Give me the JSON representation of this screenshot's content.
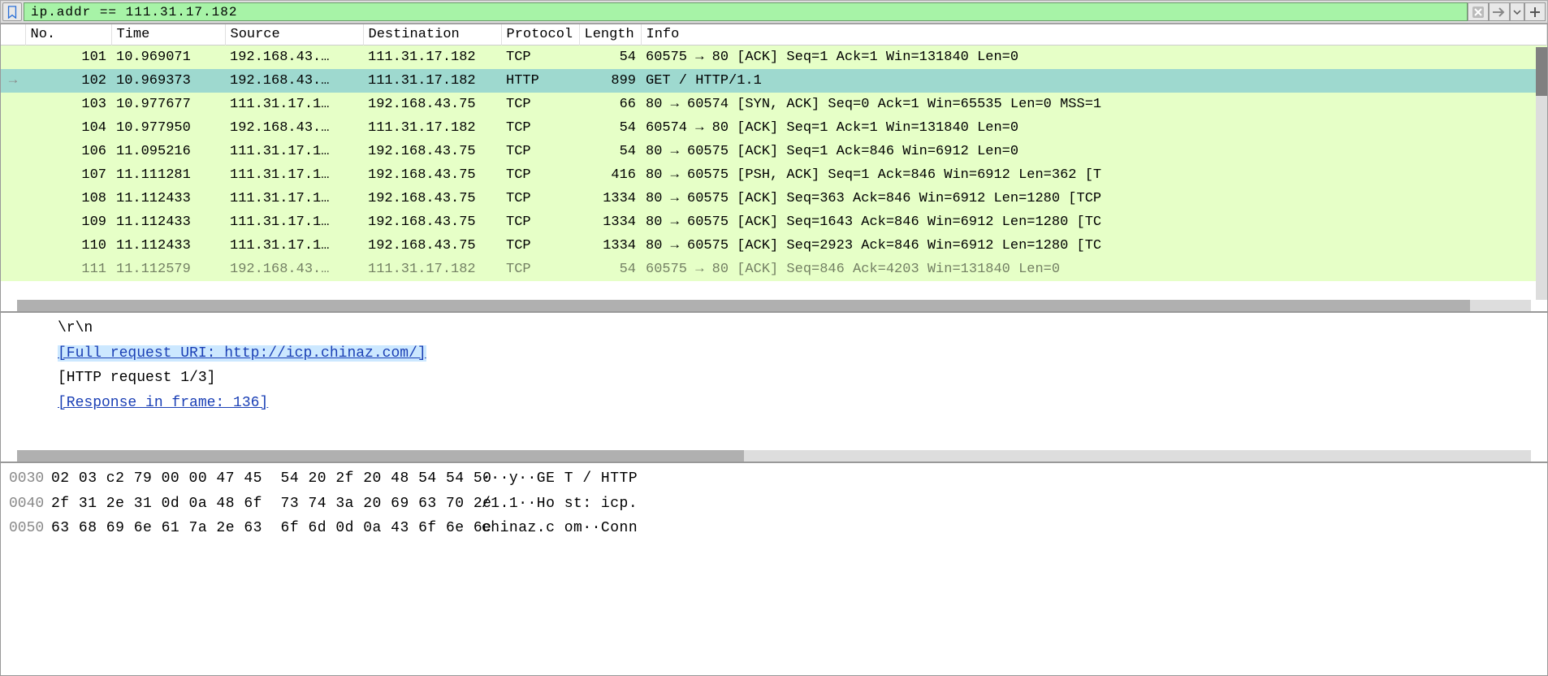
{
  "filter": {
    "value": "ip.addr == 111.31.17.182"
  },
  "columns": {
    "no": "No.",
    "time": "Time",
    "source": "Source",
    "destination": "Destination",
    "protocol": "Protocol",
    "length": "Length",
    "info": "Info"
  },
  "packets": [
    {
      "no": "101",
      "time": "10.969071",
      "src": "192.168.43.…",
      "dst": "111.31.17.182",
      "proto": "TCP",
      "len": "54",
      "info": "60575 → 80 [ACK] Seq=1 Ack=1 Win=131840 Len=0",
      "selected": false,
      "marker": ""
    },
    {
      "no": "102",
      "time": "10.969373",
      "src": "192.168.43.…",
      "dst": "111.31.17.182",
      "proto": "HTTP",
      "len": "899",
      "info": "GET / HTTP/1.1",
      "selected": true,
      "marker": "→"
    },
    {
      "no": "103",
      "time": "10.977677",
      "src": "111.31.17.1…",
      "dst": "192.168.43.75",
      "proto": "TCP",
      "len": "66",
      "info": "80 → 60574 [SYN, ACK] Seq=0 Ack=1 Win=65535 Len=0 MSS=1",
      "selected": false,
      "marker": ""
    },
    {
      "no": "104",
      "time": "10.977950",
      "src": "192.168.43.…",
      "dst": "111.31.17.182",
      "proto": "TCP",
      "len": "54",
      "info": "60574 → 80 [ACK] Seq=1 Ack=1 Win=131840 Len=0",
      "selected": false,
      "marker": ""
    },
    {
      "no": "106",
      "time": "11.095216",
      "src": "111.31.17.1…",
      "dst": "192.168.43.75",
      "proto": "TCP",
      "len": "54",
      "info": "80 → 60575 [ACK] Seq=1 Ack=846 Win=6912 Len=0",
      "selected": false,
      "marker": ""
    },
    {
      "no": "107",
      "time": "11.111281",
      "src": "111.31.17.1…",
      "dst": "192.168.43.75",
      "proto": "TCP",
      "len": "416",
      "info": "80 → 60575 [PSH, ACK] Seq=1 Ack=846 Win=6912 Len=362 [T",
      "selected": false,
      "marker": ""
    },
    {
      "no": "108",
      "time": "11.112433",
      "src": "111.31.17.1…",
      "dst": "192.168.43.75",
      "proto": "TCP",
      "len": "1334",
      "info": "80 → 60575 [ACK] Seq=363 Ack=846 Win=6912 Len=1280 [TCP",
      "selected": false,
      "marker": ""
    },
    {
      "no": "109",
      "time": "11.112433",
      "src": "111.31.17.1…",
      "dst": "192.168.43.75",
      "proto": "TCP",
      "len": "1334",
      "info": "80 → 60575 [ACK] Seq=1643 Ack=846 Win=6912 Len=1280 [TC",
      "selected": false,
      "marker": ""
    },
    {
      "no": "110",
      "time": "11.112433",
      "src": "111.31.17.1…",
      "dst": "192.168.43.75",
      "proto": "TCP",
      "len": "1334",
      "info": "80 → 60575 [ACK] Seq=2923 Ack=846 Win=6912 Len=1280 [TC",
      "selected": false,
      "marker": ""
    }
  ],
  "partial_packet": {
    "no": "111",
    "time": "11.112579",
    "src": "192.168.43.…",
    "dst": "111.31.17.182",
    "proto": "TCP",
    "len": "54",
    "info": "60575 → 80 [ACK] Seq=846 Ack=4203 Win=131840 Len=0"
  },
  "details": {
    "line1": "\\r\\n",
    "line2": "[Full request URI: http://icp.chinaz.com/]",
    "line3": "[HTTP request 1/3]",
    "line4": "[Response in frame: 136]"
  },
  "hex": [
    {
      "off": "0030",
      "bytes": "02 03 c2 79 00 00 47 45  54 20 2f 20 48 54 54 50",
      "ascii": "···y··GE T / HTTP"
    },
    {
      "off": "0040",
      "bytes": "2f 31 2e 31 0d 0a 48 6f  73 74 3a 20 69 63 70 2e",
      "ascii": "/1.1··Ho st: icp."
    },
    {
      "off": "0050",
      "bytes": "63 68 69 6e 61 7a 2e 63  6f 6d 0d 0a 43 6f 6e 6e",
      "ascii": "chinaz.c om··Conn"
    }
  ]
}
